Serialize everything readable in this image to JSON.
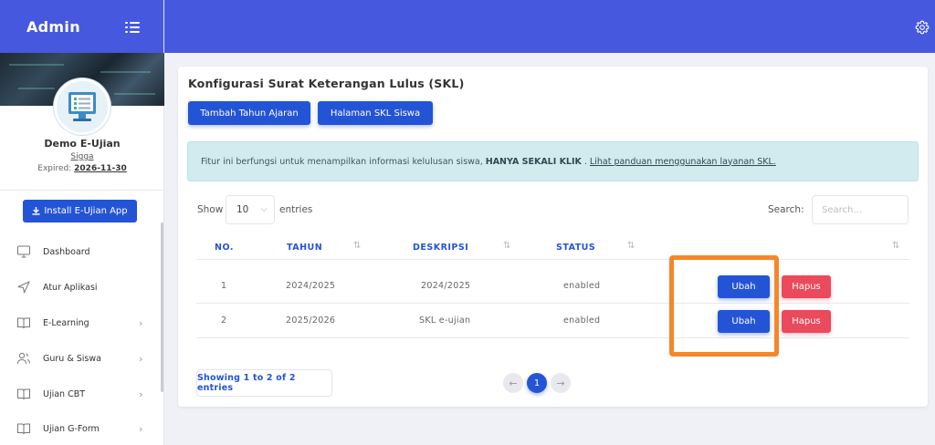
{
  "brand": {
    "title": "Admin",
    "menu_icon": "hamburger-icon"
  },
  "profile": {
    "name": "Demo E-Ujian",
    "username": "Sigga",
    "expired_label": "Expired:",
    "expired_date": "2026-11-30"
  },
  "install_button": {
    "label": "Install E-Ujian App",
    "icon": "download-icon"
  },
  "sidebar": {
    "items": [
      {
        "label": "Dashboard",
        "icon": "monitor-icon",
        "has_children": false
      },
      {
        "label": "Atur Aplikasi",
        "icon": "send-icon",
        "has_children": false
      },
      {
        "label": "E-Learning",
        "icon": "book-icon",
        "has_children": true
      },
      {
        "label": "Guru & Siswa",
        "icon": "users-icon",
        "has_children": true
      },
      {
        "label": "Ujian CBT",
        "icon": "book-icon",
        "has_children": true
      },
      {
        "label": "Ujian G-Form",
        "icon": "book-icon",
        "has_children": true
      }
    ],
    "chevron": "›"
  },
  "topbar": {
    "settings_icon": "gear-icon"
  },
  "card": {
    "title": "Konfigurasi Surat Keterangan Lulus (SKL)",
    "buttons": {
      "add_year": "Tambah Tahun Ajaran",
      "skl_page": "Halaman SKL Siswa"
    },
    "alert": {
      "text": "Fitur ini berfungsi untuk menampilkan informasi kelulusan siswa,",
      "bold": "HANYA SEKALI KLIK",
      "dot": ".",
      "link": "Lihat panduan menggunakan layanan SKL."
    }
  },
  "table_controls": {
    "show_label": "Show",
    "page_size": "10",
    "entries_label": "entries",
    "search_label": "Search:",
    "search_placeholder": "Search..."
  },
  "table": {
    "columns": [
      "NO.",
      "TAHUN",
      "DESKRIPSI",
      "STATUS"
    ],
    "sort_glyph": "⇅",
    "rows": [
      {
        "no": "1",
        "tahun": "2024/2025",
        "deskripsi": "2024/2025",
        "status": "enabled",
        "edit": "Ubah",
        "delete": "Hapus"
      },
      {
        "no": "2",
        "tahun": "2025/2026",
        "deskripsi": "SKL e-ujian",
        "status": "enabled",
        "edit": "Ubah",
        "delete": "Hapus"
      }
    ]
  },
  "footer": {
    "info": "Showing 1 to 2 of 2 entries",
    "prev": "←",
    "current_page": "1",
    "next": "→"
  },
  "colors": {
    "primary": "#2454d6",
    "topbar": "#4658de",
    "danger": "#ea4a5c",
    "highlight": "#f5862a",
    "alert_bg": "#d2ebef"
  }
}
